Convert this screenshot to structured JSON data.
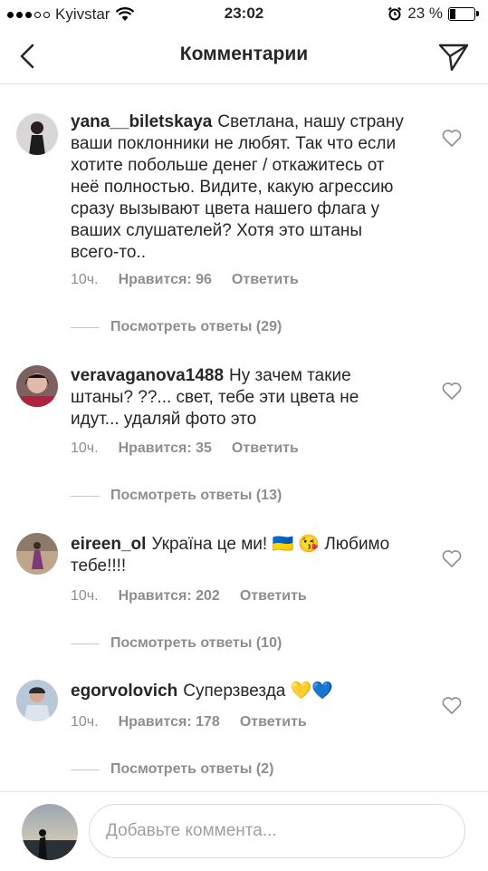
{
  "status": {
    "carrier": "Kyivstar",
    "time": "23:02",
    "battery": "23 %",
    "battery_level": 0.23
  },
  "nav": {
    "title": "Комментарии"
  },
  "comments": [
    {
      "user": "yana__biletskaya",
      "text": "Светлана, нашу страну ваши поклонники не любят. Так что если хотите побольше денег / откажитесь от неё полностью. Видите, какую агрессию сразу вызывают цвета нашего флага у ваших слушателей? Хотя это штаны всего-то..",
      "time": "10ч.",
      "likes": "Нравится: 96",
      "reply": "Ответить",
      "replies": "Посмотреть ответы (29)"
    },
    {
      "user": "veravaganova1488",
      "text": "Ну зачем такие штаны? ??... свет, тебе эти цвета не идут... удаляй фото это",
      "time": "10ч.",
      "likes": "Нравится: 35",
      "reply": "Ответить",
      "replies": "Посмотреть ответы (13)"
    },
    {
      "user": "eireen_ol",
      "text": "Україна це ми! 🇺🇦 😘 Любимо тебе!!!!",
      "time": "10ч.",
      "likes": "Нравится: 202",
      "reply": "Ответить",
      "replies": "Посмотреть ответы (10)"
    },
    {
      "user": "egorvolovich",
      "text": "Суперзвезда 💛💙",
      "time": "10ч.",
      "likes": "Нравится: 178",
      "reply": "Ответить",
      "replies": "Посмотреть ответы (2)"
    }
  ],
  "composer": {
    "placeholder": "Добавьте коммента..."
  }
}
